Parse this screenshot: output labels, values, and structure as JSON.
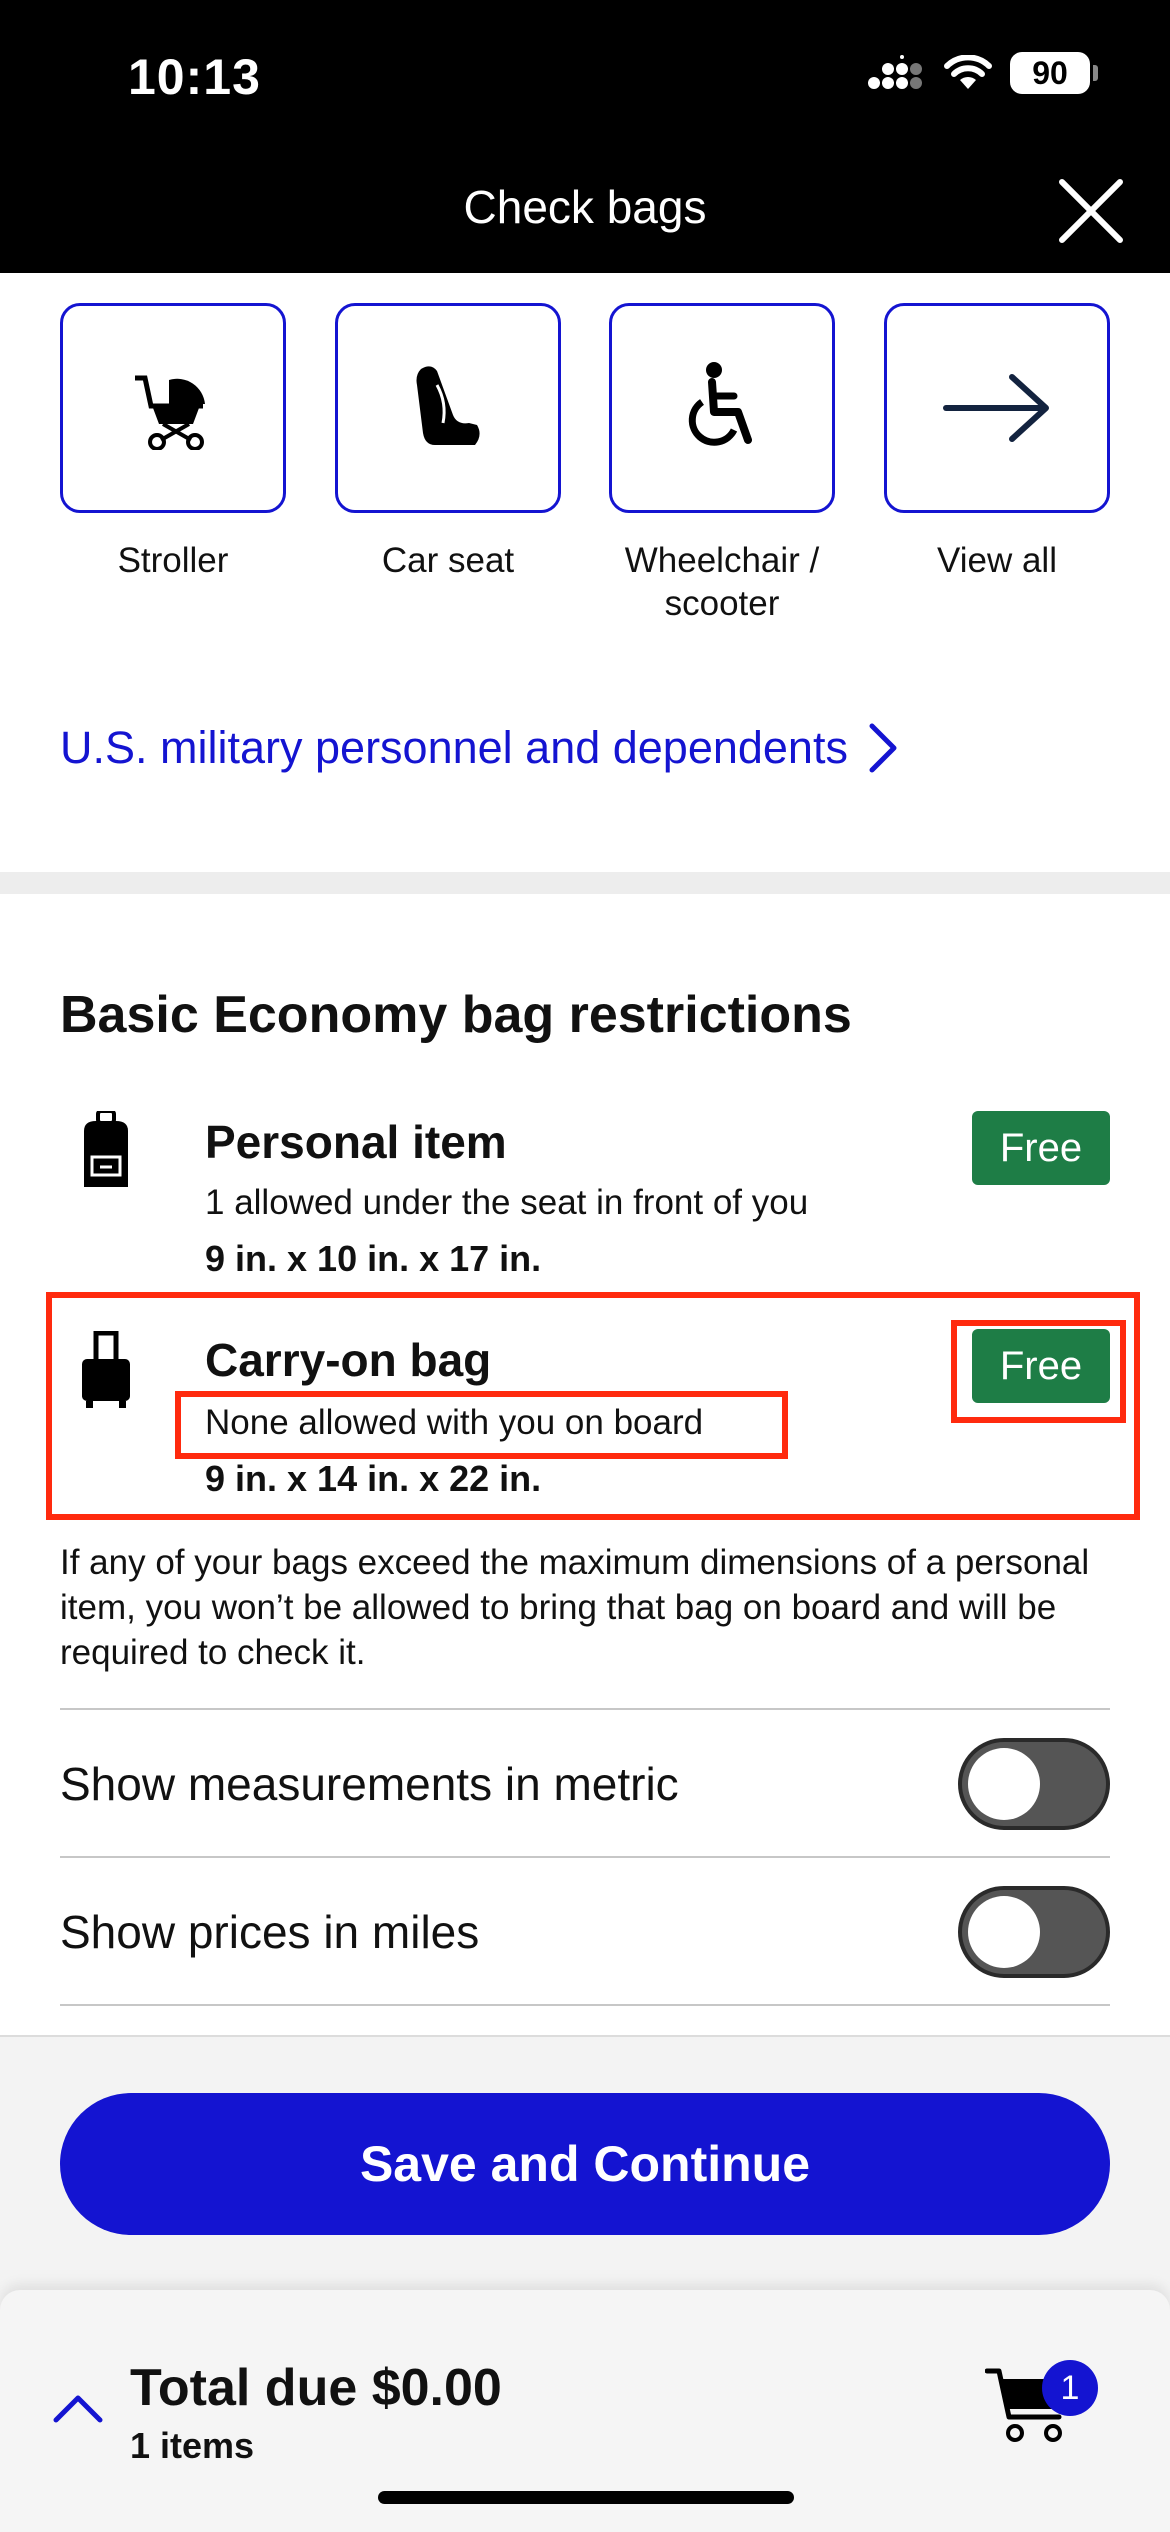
{
  "status_bar": {
    "time": "10:13",
    "battery": "90"
  },
  "header": {
    "title": "Check bags"
  },
  "special_items": [
    {
      "label": "Stroller",
      "icon": "stroller-icon"
    },
    {
      "label": "Car seat",
      "icon": "car-seat-icon"
    },
    {
      "label": "Wheelchair / scooter",
      "icon": "wheelchair-icon"
    },
    {
      "label": "View all",
      "icon": "arrow-right-icon"
    }
  ],
  "military_link": "U.S. military personnel and dependents",
  "restrictions": {
    "title": "Basic Economy bag restrictions",
    "items": [
      {
        "name": "Personal item",
        "description": "1 allowed under the seat in front of you",
        "dimensions": "9 in. x 10 in. x 17 in.",
        "price": "Free",
        "icon": "backpack-icon"
      },
      {
        "name": "Carry-on bag",
        "description": "None allowed with you on board",
        "dimensions": "9 in. x 14 in. x 22 in.",
        "price": "Free",
        "icon": "suitcase-icon"
      }
    ],
    "notice": "If any of your bags exceed the maximum dimensions of a personal item, you won’t be allowed to bring that bag on board and will be required to check it."
  },
  "toggles": [
    {
      "label": "Show measurements in metric",
      "on": false
    },
    {
      "label": "Show prices in miles",
      "on": false
    }
  ],
  "save_button": "Save and Continue",
  "summary": {
    "total": "Total due $0.00",
    "items": "1 items",
    "cart_count": "1"
  },
  "colors": {
    "brand_blue": "#1414d1",
    "free_green": "#1e7d46",
    "highlight_red": "#ff2a0e"
  }
}
